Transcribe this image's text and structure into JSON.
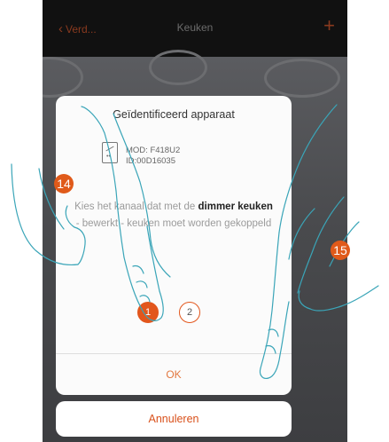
{
  "header": {
    "back_label": "Verd...",
    "title": "Keuken",
    "add_symbol": "+"
  },
  "dialog": {
    "title": "Geïdentificeerd apparaat",
    "device_icon": "switch-module-icon",
    "model_line": "MOD: F418U2",
    "id_line": "ID:00D16035",
    "instruction_prefix": "Kies het kanaal dat met de",
    "instruction_bold": "dimmer keuken",
    "instruction_suffix": "- bewerkt - keuken moet worden gekoppeld",
    "channels": [
      "1",
      "2"
    ],
    "selected_channel": "1",
    "ok_label": "OK"
  },
  "cancel_label": "Annuleren",
  "callouts": [
    "14",
    "15"
  ],
  "colors": {
    "accent": "#e2561c",
    "topbar": "#111111",
    "background_photo": "#4a4b4d",
    "dialog_bg": "#fbfbfb"
  }
}
